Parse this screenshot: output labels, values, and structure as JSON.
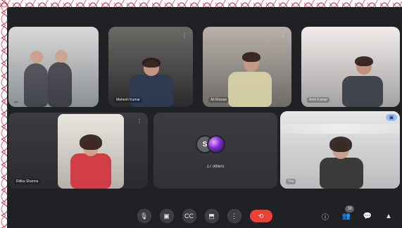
{
  "meeting": {
    "tiles": [
      {
        "id": "t1",
        "label": ""
      },
      {
        "id": "t2",
        "label": "Mahesh Kumar"
      },
      {
        "id": "t3",
        "label": "Ali Rizwan"
      },
      {
        "id": "t4",
        "label": "Amit Kumar"
      },
      {
        "id": "t5",
        "label": "Ritika Sharma"
      },
      {
        "id": "t6",
        "label": "S"
      },
      {
        "id": "t6b",
        "label": "17 others"
      },
      {
        "id": "t7",
        "label": "You"
      }
    ],
    "badges": {
      "people_count": "38"
    }
  },
  "controls": {
    "buttons": [
      {
        "key": "mic",
        "icon": "mic-icon",
        "symbol": "🎙"
      },
      {
        "key": "camera",
        "icon": "camera-icon",
        "symbol": "▣"
      },
      {
        "key": "captions",
        "icon": "captions-icon",
        "symbol": "CC"
      },
      {
        "key": "present",
        "icon": "present-icon",
        "symbol": "⬒"
      },
      {
        "key": "more",
        "icon": "more-icon",
        "symbol": "⋮"
      },
      {
        "key": "leave",
        "icon": "phone-hangup-icon",
        "symbol": "⟲"
      }
    ],
    "right": [
      {
        "key": "info",
        "icon": "info-icon",
        "symbol": "ⓘ"
      },
      {
        "key": "people",
        "icon": "people-icon",
        "symbol": "👥"
      },
      {
        "key": "chat",
        "icon": "chat-icon",
        "symbol": "💬"
      },
      {
        "key": "activities",
        "icon": "activities-icon",
        "symbol": "▲"
      }
    ]
  },
  "colors": {
    "background": "#202124",
    "accent": "#8ab4f8",
    "danger": "#ea4335"
  }
}
